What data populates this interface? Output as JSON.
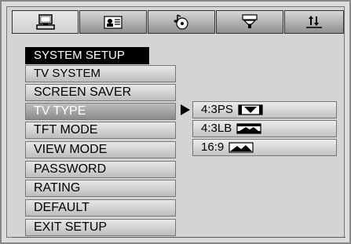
{
  "tabs": [
    {
      "icon": "computer-icon"
    },
    {
      "icon": "id-card-icon"
    },
    {
      "icon": "music-disc-icon"
    },
    {
      "icon": "speaker-funnel-icon"
    },
    {
      "icon": "sort-arrows-icon"
    }
  ],
  "menu": {
    "header": "SYSTEM SETUP",
    "items": [
      {
        "label": "TV SYSTEM"
      },
      {
        "label": "SCREEN SAVER"
      },
      {
        "label": "TV TYPE"
      },
      {
        "label": "TFT MODE"
      },
      {
        "label": "VIEW MODE"
      },
      {
        "label": "PASSWORD"
      },
      {
        "label": "RATING"
      },
      {
        "label": "DEFAULT"
      },
      {
        "label": "EXIT SETUP"
      }
    ]
  },
  "options": [
    {
      "label": "4:3PS",
      "icon": "pan-scan-icon"
    },
    {
      "label": "4:3LB",
      "icon": "letterbox-icon"
    },
    {
      "label": "16:9",
      "icon": "widescreen-icon"
    }
  ]
}
